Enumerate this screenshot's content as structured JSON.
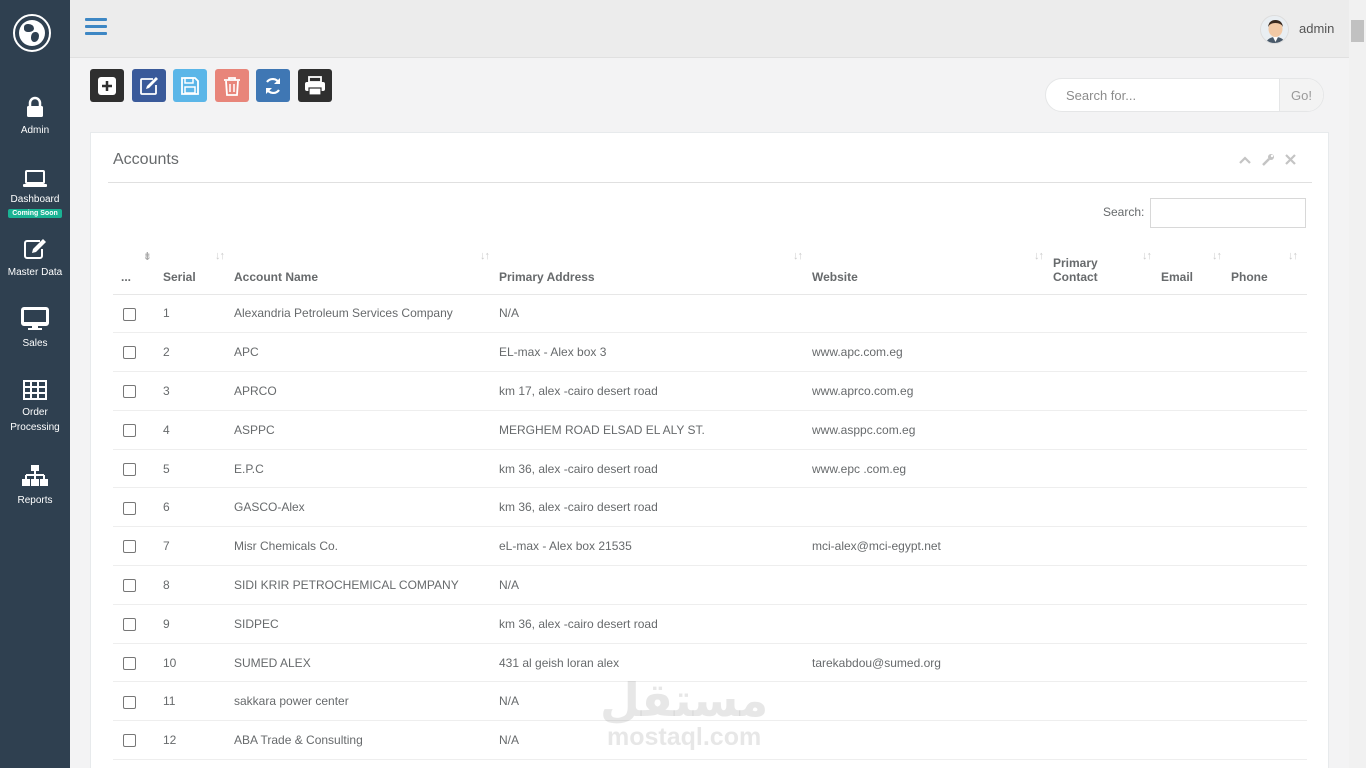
{
  "sidebar": {
    "items": [
      {
        "label": "Admin",
        "icon": "lock-icon"
      },
      {
        "label": "Dashboard",
        "icon": "laptop-icon",
        "badge": "Coming Soon"
      },
      {
        "label": "Master Data",
        "icon": "edit-icon"
      },
      {
        "label": "Sales",
        "icon": "monitor-icon"
      },
      {
        "label": "Order Processing",
        "icon": "grid-icon"
      },
      {
        "label": "Reports",
        "icon": "sitemap-icon"
      }
    ]
  },
  "header": {
    "user": "admin"
  },
  "toolbar": {
    "buttons": [
      "add",
      "edit",
      "save",
      "delete",
      "refresh",
      "print"
    ]
  },
  "search": {
    "placeholder": "Search for...",
    "go_label": "Go!"
  },
  "panel": {
    "title": "Accounts",
    "search_label": "Search:",
    "columns": [
      "...",
      "Serial",
      "Account Name",
      "Primary Address",
      "Website",
      "Primary Contact",
      "Email",
      "Phone"
    ],
    "rows": [
      {
        "serial": "1",
        "name": "Alexandria Petroleum Services Company",
        "address": "N/A",
        "website": ""
      },
      {
        "serial": "2",
        "name": "APC",
        "address": "EL-max - Alex box 3",
        "website": "www.apc.com.eg"
      },
      {
        "serial": "3",
        "name": "APRCO",
        "address": "km 17, alex -cairo desert road",
        "website": "www.aprco.com.eg"
      },
      {
        "serial": "4",
        "name": "ASPPC",
        "address": "MERGHEM ROAD ELSAD EL ALY ST.",
        "website": "www.asppc.com.eg"
      },
      {
        "serial": "5",
        "name": "E.P.C",
        "address": "km 36, alex -cairo desert road",
        "website": "www.epc .com.eg"
      },
      {
        "serial": "6",
        "name": "GASCO-Alex",
        "address": "km 36, alex -cairo desert road",
        "website": ""
      },
      {
        "serial": "7",
        "name": "Misr Chemicals Co.",
        "address": "eL-max - Alex box 21535",
        "website": "mci-alex@mci-egypt.net"
      },
      {
        "serial": "8",
        "name": "SIDI KRIR PETROCHEMICAL COMPANY",
        "address": "N/A",
        "website": ""
      },
      {
        "serial": "9",
        "name": "SIDPEC",
        "address": "km 36, alex -cairo desert road",
        "website": ""
      },
      {
        "serial": "10",
        "name": "SUMED ALEX",
        "address": "431 al geish loran alex",
        "website": "tarekabdou@sumed.org"
      },
      {
        "serial": "11",
        "name": "sakkara power center",
        "address": "N/A",
        "website": ""
      },
      {
        "serial": "12",
        "name": "ABA Trade & Consulting",
        "address": "N/A",
        "website": ""
      }
    ]
  },
  "watermark": {
    "arabic": "مستقل",
    "latin": "mostaql.com"
  }
}
